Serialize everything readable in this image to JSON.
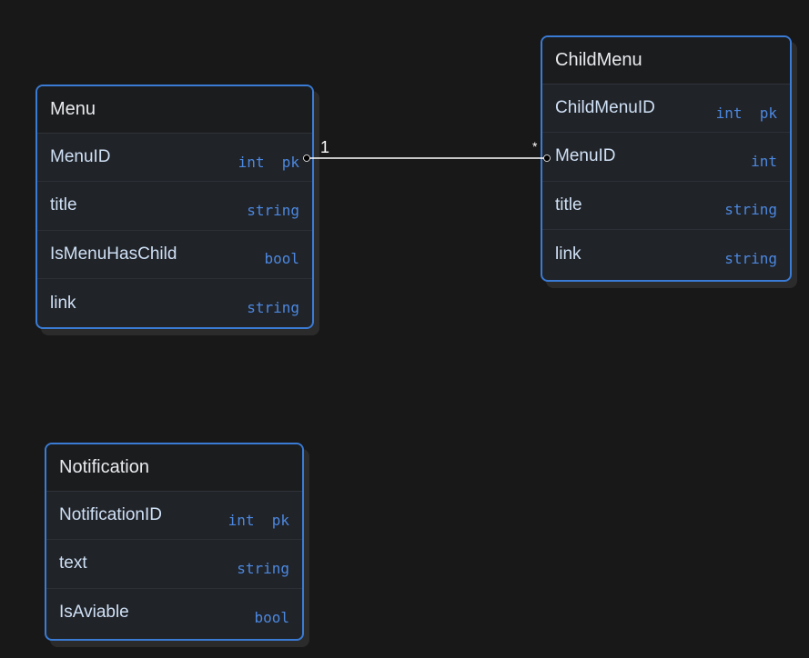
{
  "tables": {
    "menu": {
      "name": "Menu",
      "fields": [
        {
          "name": "MenuID",
          "type": "int  pk"
        },
        {
          "name": "title",
          "type": "string"
        },
        {
          "name": "IsMenuHasChild",
          "type": "bool"
        },
        {
          "name": "link",
          "type": "string"
        }
      ]
    },
    "childmenu": {
      "name": "ChildMenu",
      "fields": [
        {
          "name": "ChildMenuID",
          "type": "int  pk"
        },
        {
          "name": "MenuID",
          "type": "int"
        },
        {
          "name": "title",
          "type": "string"
        },
        {
          "name": "link",
          "type": "string"
        }
      ]
    },
    "notification": {
      "name": "Notification",
      "fields": [
        {
          "name": "NotificationID",
          "type": "int  pk"
        },
        {
          "name": "text",
          "type": "string"
        },
        {
          "name": "IsAviable",
          "type": "bool"
        }
      ]
    }
  },
  "relationship": {
    "from_cardinality": "1",
    "to_cardinality": "*"
  },
  "colors": {
    "background": "#181818",
    "border": "#3a7bd5",
    "type_text": "#4c88e0",
    "field_text": "#cfe0f5",
    "line": "#ffffff"
  }
}
